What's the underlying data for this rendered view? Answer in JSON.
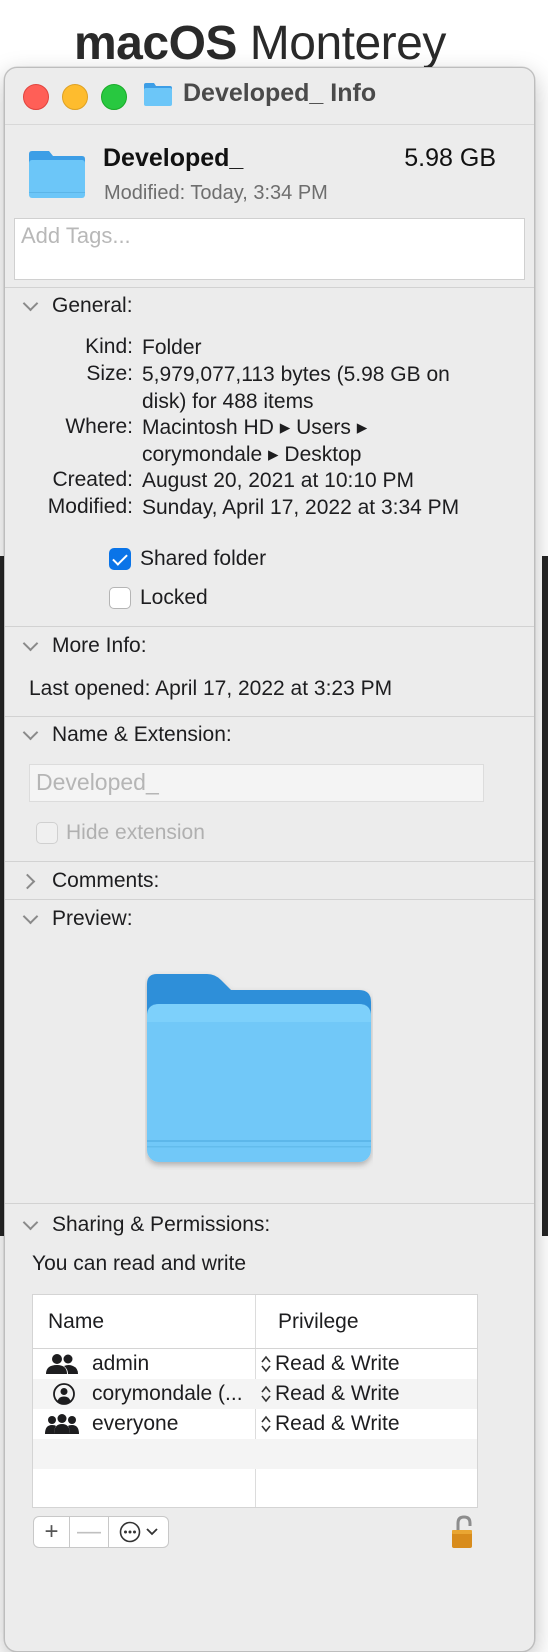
{
  "background": {
    "title_bold": "macOS",
    "title_light": "Monterey"
  },
  "window": {
    "title": "Developed_ Info",
    "folder_color": "#5ac8fa"
  },
  "header": {
    "name": "Developed_",
    "size": "5.98 GB",
    "modified": "Modified: Today, 3:34 PM"
  },
  "tags": {
    "placeholder": "Add Tags..."
  },
  "general": {
    "heading": "General:",
    "kind_label": "Kind:",
    "kind_value": "Folder",
    "size_label": "Size:",
    "size_value_line1": "5,979,077,113 bytes (5.98 GB on",
    "size_value_line2": "disk) for 488 items",
    "where_label": "Where:",
    "where_value_line1": "Macintosh HD ▸ Users ▸",
    "where_value_line2": "corymondale ▸ Desktop",
    "created_label": "Created:",
    "created_value": "August 20, 2021 at 10:10 PM",
    "modified_label": "Modified:",
    "modified_value": "Sunday, April 17, 2022 at 3:34 PM",
    "shared_folder_label": "Shared folder",
    "shared_folder_checked": true,
    "locked_label": "Locked",
    "locked_checked": false
  },
  "more_info": {
    "heading": "More Info:",
    "last_opened": "Last opened: April 17, 2022 at 3:23 PM"
  },
  "name_extension": {
    "heading": "Name & Extension:",
    "name_value": "Developed_",
    "hide_extension_label": "Hide extension"
  },
  "comments": {
    "heading": "Comments:"
  },
  "preview": {
    "heading": "Preview:"
  },
  "sharing": {
    "heading": "Sharing & Permissions:",
    "summary": "You can read and write",
    "col_name": "Name",
    "col_privilege": "Privilege",
    "rows": [
      {
        "user": "admin",
        "privilege": "Read & Write",
        "icon": "group-icon"
      },
      {
        "user": "corymondale (...",
        "privilege": "Read & Write",
        "icon": "user-circle-icon"
      },
      {
        "user": "everyone",
        "privilege": "Read & Write",
        "icon": "everyone-icon"
      }
    ],
    "add_label": "+",
    "remove_label": "—",
    "accent": "#0a74e8"
  }
}
